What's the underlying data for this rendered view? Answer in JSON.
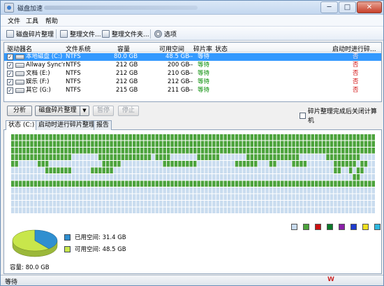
{
  "window": {
    "title": "磁盘加速",
    "controls": {
      "minimize": "─",
      "maximize": "□",
      "close": "✕"
    }
  },
  "menu": [
    "文件",
    "工具",
    "帮助"
  ],
  "toolbar": {
    "defrag": "磁盘碎片整理",
    "defrag_file": "整理文件...",
    "defrag_folder": "整理文件夹...",
    "options": "选项"
  },
  "list": {
    "columns": {
      "drive": "驱动器名",
      "fs": "文件系统",
      "capacity": "容量",
      "free": "可用空间",
      "frag": "碎片率",
      "status": "状态",
      "startup": "启动时进行碎..."
    },
    "rows": [
      {
        "name": "本地磁盘 (C:)",
        "fs": "NTFS",
        "capacity": "80.0 GB",
        "free": "48.5 GB",
        "frag": "--",
        "status": "等待",
        "startup": "否"
      },
      {
        "name": "Allway Sync'n...",
        "fs": "NTFS",
        "capacity": "212 GB",
        "free": "200 GB",
        "frag": "--",
        "status": "等待",
        "startup": "否"
      },
      {
        "name": "文档 (E:)",
        "fs": "NTFS",
        "capacity": "212 GB",
        "free": "210 GB",
        "frag": "--",
        "status": "等待",
        "startup": "否"
      },
      {
        "name": "娱乐 (F:)",
        "fs": "NTFS",
        "capacity": "212 GB",
        "free": "212 GB",
        "frag": "--",
        "status": "等待",
        "startup": "否"
      },
      {
        "name": "其它 (G:)",
        "fs": "NTFS",
        "capacity": "215 GB",
        "free": "211 GB",
        "frag": "--",
        "status": "等待",
        "startup": "否"
      }
    ]
  },
  "actions": {
    "analyze": "分析",
    "defrag": "磁盘碎片整理",
    "pause": "暂停",
    "stop": "停止",
    "shutdown_after": "碎片整理完成后关闭计算机"
  },
  "tabs": [
    "状态 (C:)",
    "启动时进行碎片整理",
    "报告"
  ],
  "disk_map": {
    "colors": {
      "used": "#4ca33c",
      "free": "#c9dcef"
    },
    "rows": [
      "################################################################################################",
      "################################################################################################",
      "################################################################################################",
      "################.......##############.####.......######.......##############.......#########.",
      "##.....###..............#####...........#########..........######...##....####.......######.##",
      ".........#######.....######..........................................................##..#.##.",
      "..........................................................................................##.",
      "################################################################################################",
      "................................................................................................",
      "................................................................................................",
      "................................................................................................",
      "................................................................................................"
    ]
  },
  "legend": {
    "colors": [
      "#c9dcef",
      "#4ca33c",
      "#cc1010",
      "#0a7a2a",
      "#8a1fa8",
      "#1f3ccf",
      "#f0e020",
      "#2fb8e0"
    ]
  },
  "usage": {
    "used_label": "已用空间: 31.4 GB",
    "free_label": "可用空间: 48.5 GB",
    "used_fraction": 0.3925,
    "used_color": "#2f8fd0",
    "free_color": "#c8e64b",
    "capacity_label": "容量: 80.0 GB"
  },
  "status_bar": {
    "text": "等待"
  }
}
